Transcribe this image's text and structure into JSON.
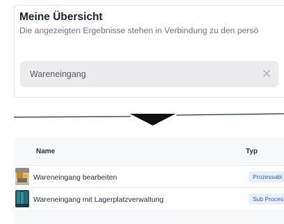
{
  "overview": {
    "title": "Meine Übersicht",
    "subtitle": "Die angezeigten Ergebnisse stehen in Verbindung zu den persö",
    "search": {
      "value": "Wareneingang",
      "clear_icon": "close-icon"
    }
  },
  "divider": {
    "icon": "triangle-down-icon"
  },
  "table": {
    "columns": {
      "name": "Name",
      "type": "Typ"
    },
    "rows": [
      {
        "name": "Wareneingang bearbeiten",
        "type": "Prozessabl"
      },
      {
        "name": "Wareneingang mit Lagerplatzverwaltung",
        "type": "Sub Proces"
      }
    ]
  },
  "colors": {
    "badge_bg": "#e7effd",
    "badge_text": "#2f5fcf",
    "search_bg": "#ececef"
  }
}
